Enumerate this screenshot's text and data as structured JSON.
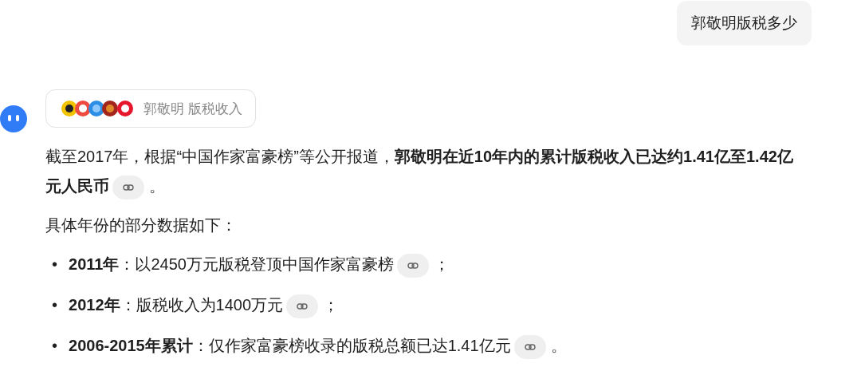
{
  "user_message": "郭敬明版税多少",
  "sources": {
    "label": "郭敬明 版税收入"
  },
  "intro": {
    "text": "截至2017年，根据“中国作家富豪榜”等公开报道，**郭敬明在近10年内的累计版税收入已达约1.41亿至1.42亿元人民币**",
    "end": "。"
  },
  "list_heading": "具体年份的部分数据如下：",
  "items": [
    {
      "marker": "•",
      "text": "**2011年**：以2450万元版税登顶中国作家富豪榜",
      "end": "；"
    },
    {
      "marker": "•",
      "text": "**2012年**：版税收入为1400万元",
      "end": "；"
    },
    {
      "marker": "•",
      "text": "**2006-2015年累计**：仅作家富豪榜收录的版税总额已达1.41亿元",
      "end": "。"
    }
  ]
}
